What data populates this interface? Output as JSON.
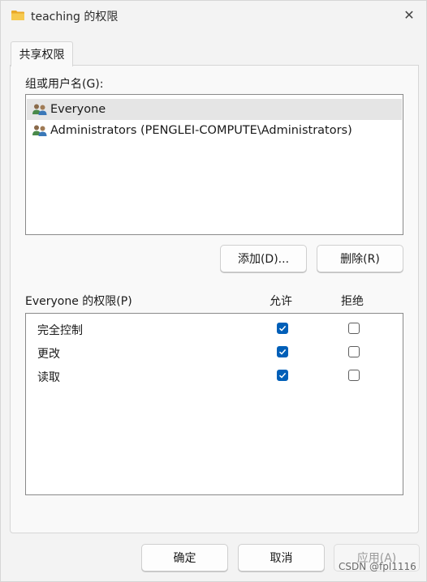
{
  "window": {
    "title": "teaching 的权限",
    "close_symbol": "✕"
  },
  "tab": {
    "label": "共享权限"
  },
  "groups": {
    "label": "组或用户名(G):",
    "items": [
      {
        "label": "Everyone",
        "selected": true
      },
      {
        "label": "Administrators (PENGLEI-COMPUTE\\Administrators)",
        "selected": false
      }
    ],
    "add_button": "添加(D)...",
    "remove_button": "删除(R)"
  },
  "permissions": {
    "label": "Everyone 的权限(P)",
    "allow_header": "允许",
    "deny_header": "拒绝",
    "rows": [
      {
        "name": "完全控制",
        "allow": true,
        "deny": false
      },
      {
        "name": "更改",
        "allow": true,
        "deny": false
      },
      {
        "name": "读取",
        "allow": true,
        "deny": false
      }
    ]
  },
  "footer": {
    "ok": "确定",
    "cancel": "取消",
    "apply": "应用(A)"
  },
  "watermark": "CSDN @fpl1116",
  "colors": {
    "accent": "#005fb8",
    "folder": "#f2c14e"
  }
}
